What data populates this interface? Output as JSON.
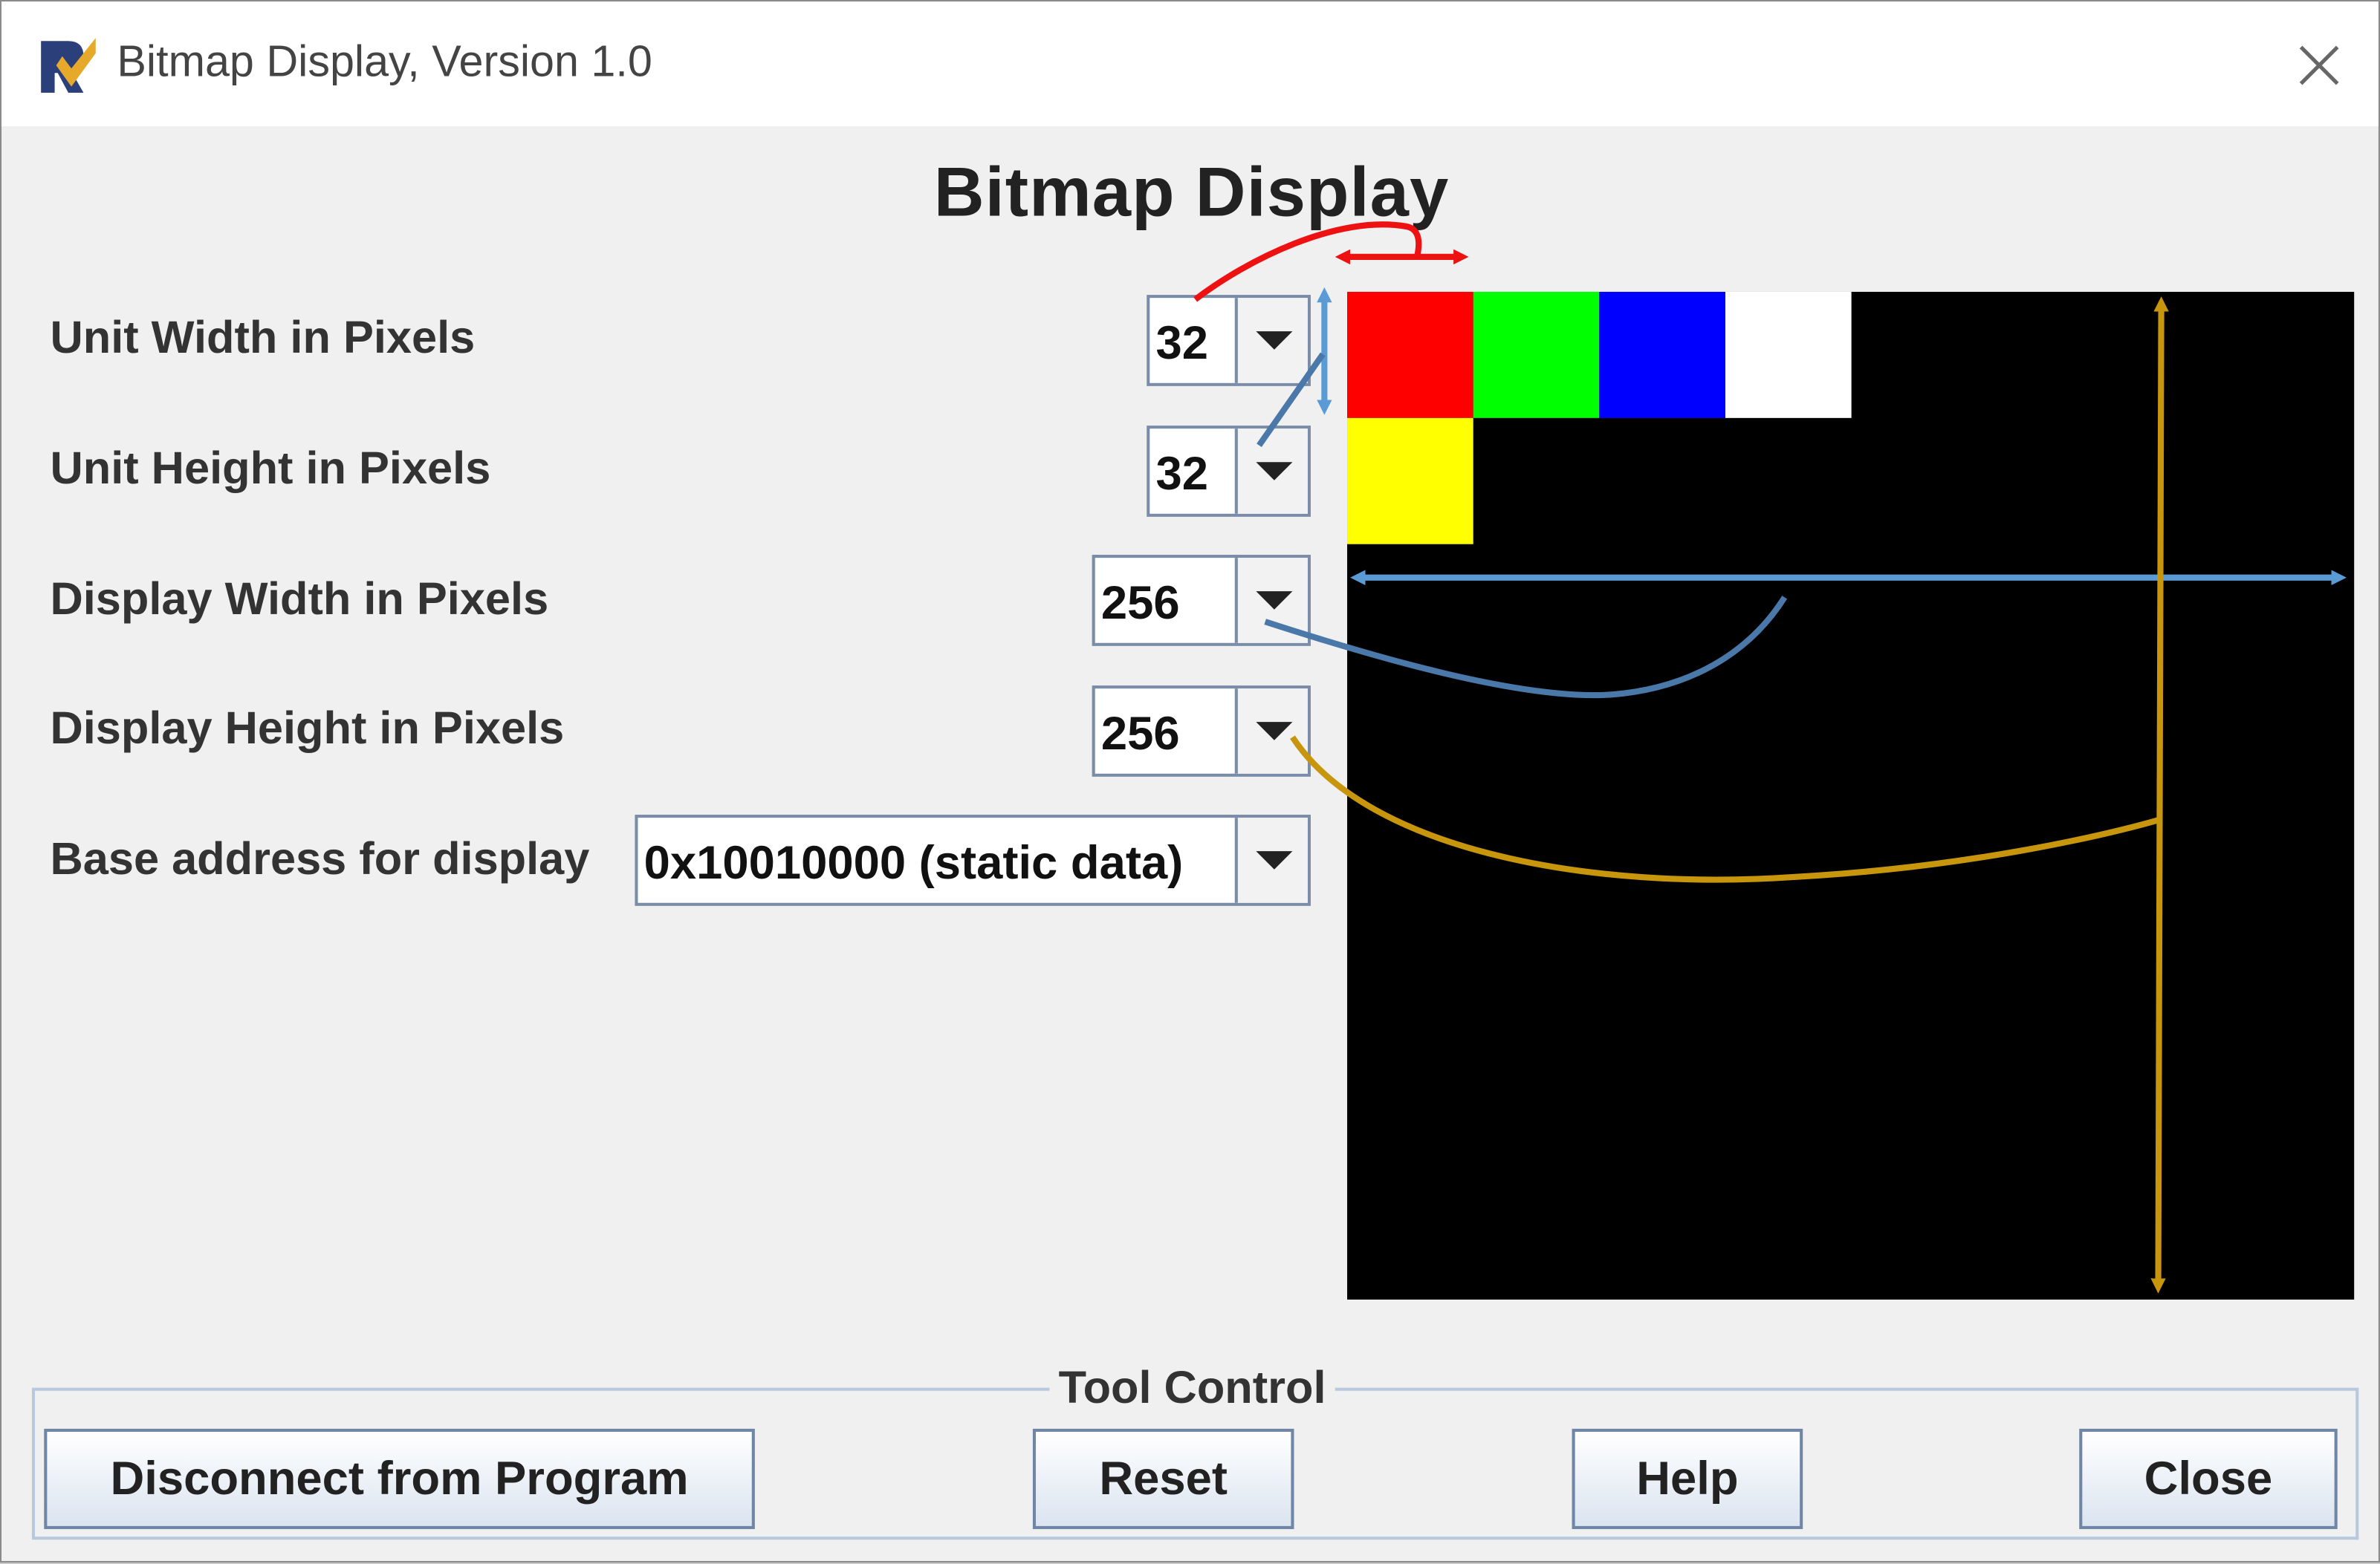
{
  "window": {
    "title": "Bitmap Display, Version 1.0",
    "heading": "Bitmap Display"
  },
  "settings": {
    "unit_width": {
      "label": "Unit Width in Pixels",
      "value": "32"
    },
    "unit_height": {
      "label": "Unit Height in Pixels",
      "value": "32"
    },
    "display_width": {
      "label": "Display Width in Pixels",
      "value": "256"
    },
    "display_height": {
      "label": "Display Height in Pixels",
      "value": "256"
    },
    "base_address": {
      "label": "Base address for display",
      "value": "0x10010000 (static data)"
    }
  },
  "display": {
    "background": "#000000",
    "units": [
      {
        "name": "red",
        "color": "#ff0000",
        "row": 0,
        "col": 0
      },
      {
        "name": "green",
        "color": "#00ff00",
        "row": 0,
        "col": 1
      },
      {
        "name": "blue",
        "color": "#0000ff",
        "row": 0,
        "col": 2
      },
      {
        "name": "white",
        "color": "#ffffff",
        "row": 0,
        "col": 3
      },
      {
        "name": "yellow",
        "color": "#ffff00",
        "row": 1,
        "col": 0
      }
    ]
  },
  "tool_control": {
    "legend": "Tool Control",
    "buttons": {
      "disconnect": "Disconnect from Program",
      "reset": "Reset",
      "help": "Help",
      "close": "Close"
    }
  },
  "annotation_colors": {
    "unit_width": "#ee1111",
    "unit_height": "#5b9bd5",
    "display_width": "#4a78a8",
    "display_height": "#c8960c"
  },
  "icons": [
    "rars-app-icon",
    "close-icon",
    "chevron-down-icon"
  ]
}
